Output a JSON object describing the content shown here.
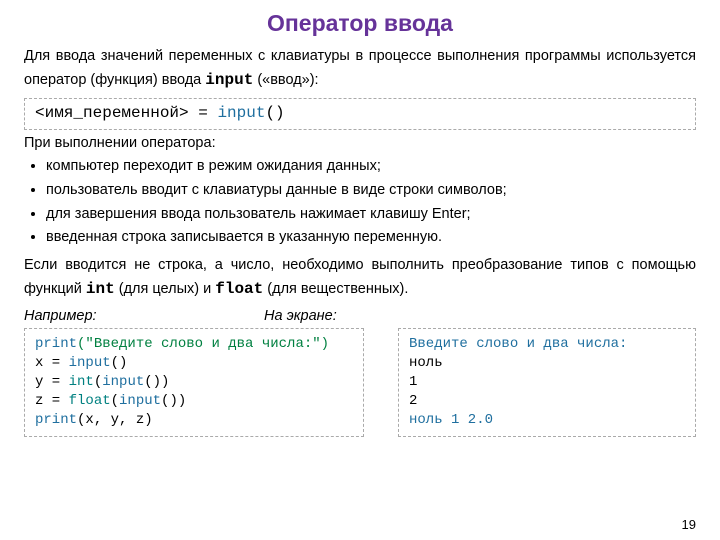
{
  "title": "Оператор ввода",
  "intro_a": "Для ввода значений переменных с клавиатуры в процессе выполнения программы используется оператор (функция) ввода ",
  "intro_kw": "input",
  "intro_b": " («ввод»):",
  "syntax": {
    "lhs": "<имя_переменной>",
    "eq": " = ",
    "fn": "input",
    "parens": "()"
  },
  "p_exec": "При выполнении оператора:",
  "bullets": [
    "компьютер переходит в режим ожидания данных;",
    "пользователь вводит с клавиатуры данные в виде строки символов;",
    "для завершения ввода пользователь нажимает клавишу Enter;",
    "введенная строка записывается в указанную переменную."
  ],
  "para2_a": "Если вводится не строка, а число, необходимо выполнить преобразование типов с помощью функций ",
  "para2_kw1": "int",
  "para2_mid": " (для целых) и ",
  "para2_kw2": "float",
  "para2_end": " (для вещественных).",
  "label_example": "Например:",
  "label_screen": "На экране:",
  "code": {
    "l1_kw": "print",
    "l1_rest": "(\"Введите слово и два числа:\")",
    "l2_var": "x = ",
    "l2_fn": "input",
    "l2_end": "()",
    "l3_var": "y = ",
    "l3_fn1": "int",
    "l3_mid": "(",
    "l3_fn2": "input",
    "l3_end": "())",
    "l4_var": "z = ",
    "l4_fn1": "float",
    "l4_mid": "(",
    "l4_fn2": "input",
    "l4_end": "())",
    "l5_kw": "print",
    "l5_rest": "(x, y, z)"
  },
  "output": {
    "prompt": "Введите слово и два числа:",
    "in1": "ноль",
    "in2": "1",
    "in3": "2",
    "result": "ноль 1 2.0"
  },
  "page_number": "19"
}
